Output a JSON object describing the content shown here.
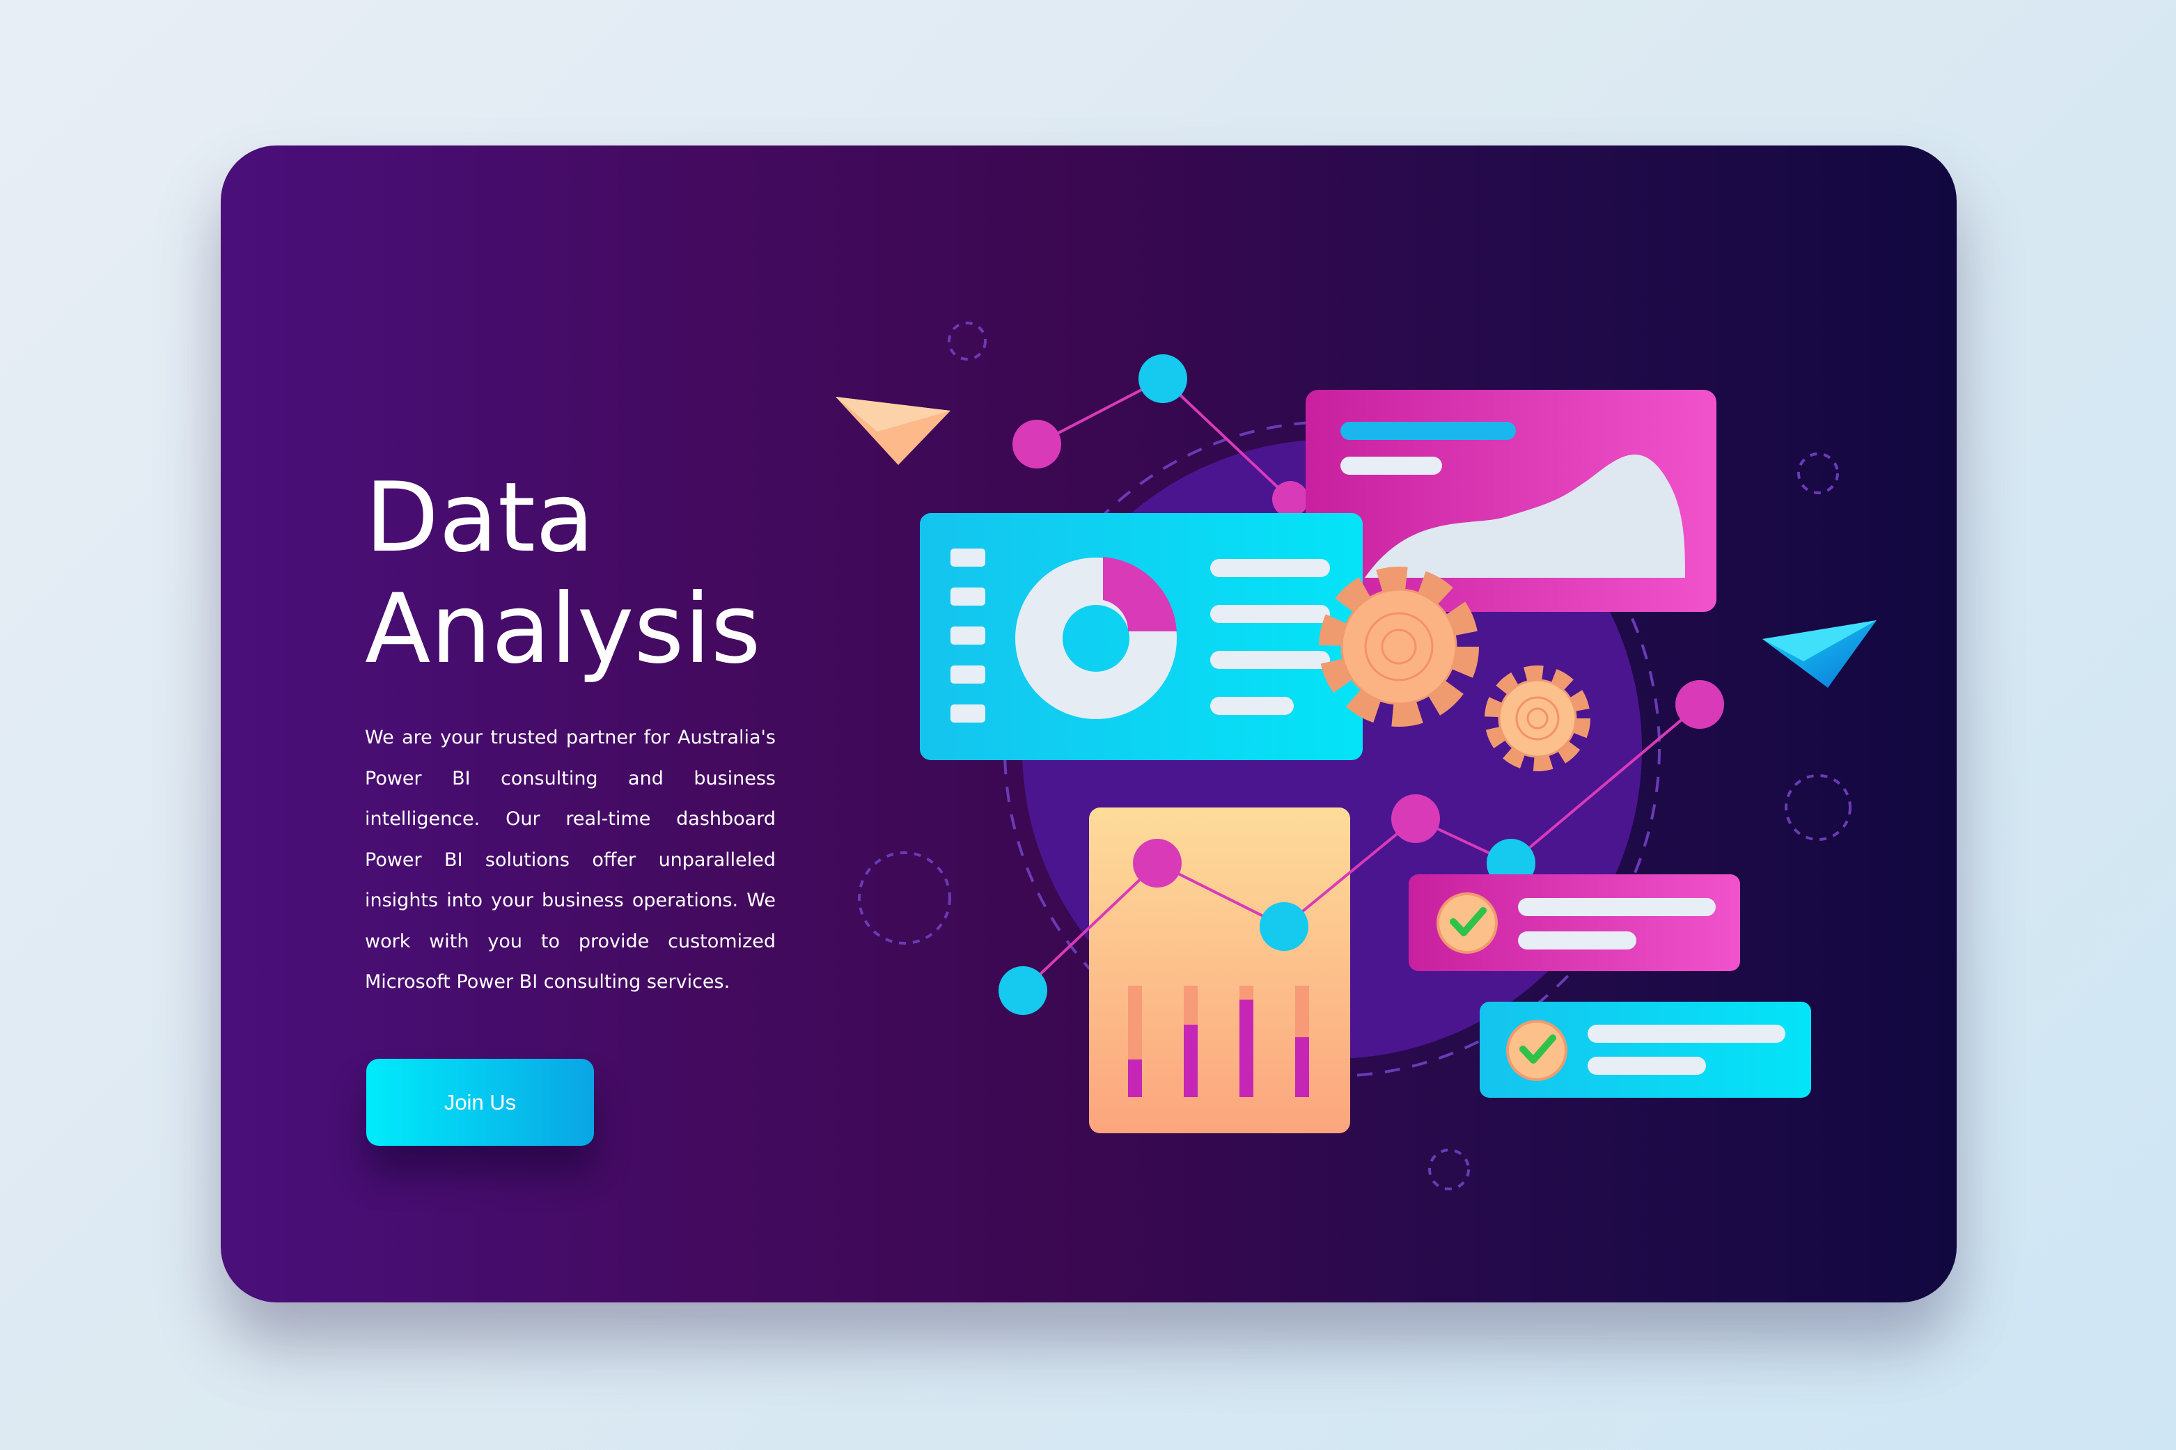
{
  "hero": {
    "title_line1": "Data",
    "title_line2": "Analysis",
    "description": "We are your trusted partner for Australia's Power BI consulting and business intelligence. Our real-time dashboard Power BI solutions offer unparalleled insights into your business operations. We work with you to provide customized Microsoft Power BI consulting services.",
    "cta_label": "Join Us"
  },
  "colors": {
    "accent_cyan": "#00d9f5",
    "accent_pink": "#e23fc0",
    "accent_orange": "#fbb587",
    "card_purple": "#430a5e"
  },
  "illustration": {
    "icons": [
      "paper-plane-icon",
      "gear-icon",
      "donut-chart-icon",
      "area-chart-icon",
      "bar-chart-icon",
      "checkmark-icon"
    ]
  }
}
